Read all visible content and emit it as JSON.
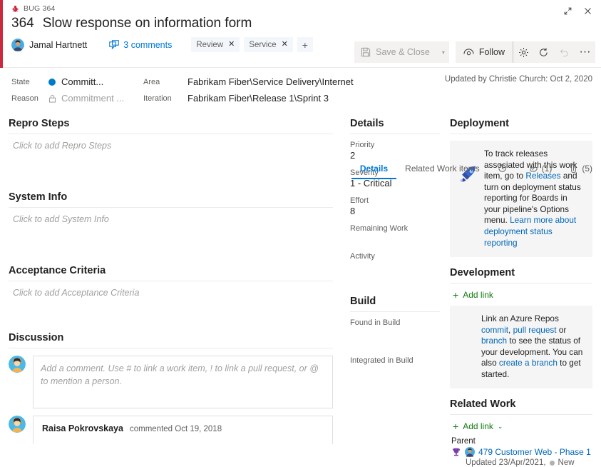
{
  "window": {
    "breadcrumb": "BUG 364",
    "expand_icon": "expand-icon",
    "close_icon": "close-icon"
  },
  "header": {
    "work_item_id": "364",
    "title": "Slow response on information form",
    "assignee": "Jamal Hartnett",
    "comments_label": "3 comments",
    "tags": [
      {
        "label": "Review"
      },
      {
        "label": "Service"
      }
    ],
    "add_tag_label": "+",
    "updated_by": "Updated by Christie Church: Oct 2, 2020"
  },
  "toolbar": {
    "save_label": "Save & Close",
    "save_caret": "▾",
    "follow_label": "Follow",
    "settings_icon": "gear-icon",
    "refresh_icon": "refresh-icon",
    "undo_icon": "undo-icon",
    "more_icon": "more-actions-icon",
    "more_label": "···"
  },
  "fields": {
    "state_label": "State",
    "state_value": "Committ...",
    "reason_label": "Reason",
    "reason_value": "Commitment ...",
    "area_label": "Area",
    "area_value": "Fabrikam Fiber\\Service Delivery\\Internet",
    "iteration_label": "Iteration",
    "iteration_value": "Fabrikam Fiber\\Release 1\\Sprint 3",
    "state_color": "#007acc"
  },
  "tabs": [
    {
      "label": "Details",
      "active": true
    },
    {
      "label": "Related Work items",
      "active": false
    },
    {
      "label": "",
      "icon": "history-icon",
      "active": false
    },
    {
      "label": "(1)",
      "icon": "link-icon",
      "active": false
    },
    {
      "label": "(5)",
      "icon": "attachment-icon",
      "active": false
    }
  ],
  "left": {
    "repro_title": "Repro Steps",
    "repro_placeholder": "Click to add Repro Steps",
    "system_title": "System Info",
    "system_placeholder": "Click to add System Info",
    "acceptance_title": "Acceptance Criteria",
    "acceptance_placeholder": "Click to add Acceptance Criteria",
    "discussion_title": "Discussion",
    "comment_placeholder": "Add a comment. Use # to link a work item, ! to link a pull request, or @ to mention a person.",
    "comment": {
      "author": "Raisa Pokrovskaya",
      "when": "commented Oct 19, 2018"
    }
  },
  "details": {
    "title": "Details",
    "priority_label": "Priority",
    "priority_value": "2",
    "severity_label": "Severity",
    "severity_value": "1 - Critical",
    "effort_label": "Effort",
    "effort_value": "8",
    "remaining_label": "Remaining Work",
    "remaining_value": "",
    "activity_label": "Activity",
    "activity_value": "",
    "build_title": "Build",
    "found_label": "Found in Build",
    "found_value": "",
    "integrated_label": "Integrated in Build",
    "integrated_value": ""
  },
  "deployment": {
    "title": "Deployment",
    "icon": "rocket-icon",
    "text_1": "To track releases associated with this work item, go to ",
    "link_releases": "Releases",
    "text_2": " and turn on deployment status reporting for Boards in your pipeline's Options menu. ",
    "link_learn": "Learn more about deployment status reporting"
  },
  "development": {
    "title": "Development",
    "add_link_label": "Add link",
    "text_1": "Link an Azure Repos ",
    "link_commit": "commit",
    "text_2": ", ",
    "link_pr": "pull request",
    "text_3": " or ",
    "link_branch": "branch",
    "text_4": " to see the status of your development. You can also ",
    "link_create": "create a branch",
    "text_5": " to get started."
  },
  "related_work": {
    "title": "Related Work",
    "add_link_label": "Add link",
    "add_link_chevron": "⌄",
    "parent_label": "Parent",
    "parent_icon": "epic-trophy-icon",
    "parent_link": "479 Customer Web - Phase 1",
    "parent_updated": "Updated 23/Apr/2021,",
    "parent_state": "New"
  }
}
